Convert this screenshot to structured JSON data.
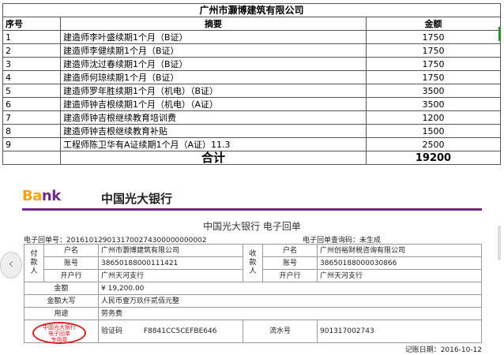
{
  "ledger": {
    "company": "广州市灏博建筑有限公司",
    "headers": {
      "no": "序号",
      "desc": "摘要",
      "amount": "金额"
    },
    "rows": [
      {
        "no": "1",
        "desc": "建造师李叶盛续期1个月（B证）",
        "amount": "1750"
      },
      {
        "no": "2",
        "desc": "建造师李健续期1个月（B证）",
        "amount": "1750"
      },
      {
        "no": "3",
        "desc": "建造师沈过春续期1个月（B证）",
        "amount": "1750"
      },
      {
        "no": "4",
        "desc": "建造师何琼续期1个月（B证）",
        "amount": "1750"
      },
      {
        "no": "5",
        "desc": "建造师罗年胜续期1个月（机电）（B证）",
        "amount": "3500"
      },
      {
        "no": "6",
        "desc": "建造师钟吉根续期1个月（机电）（A证）",
        "amount": "3500"
      },
      {
        "no": "7",
        "desc": "建造师钟吉根继续教育培训费",
        "amount": "1200"
      },
      {
        "no": "8",
        "desc": "建造师钟吉根继续教育补贴",
        "amount": "1500"
      },
      {
        "no": "9",
        "desc": "工程师陈卫华有A证续期1个月（A证）11.3",
        "amount": "2500"
      }
    ],
    "total_label": "合计",
    "total_amount": "19200",
    "accent_green": "#2e8b2e"
  },
  "bank": {
    "logo_text_1": "Ba",
    "logo_text_2": "nk",
    "name": "中国光大银行",
    "brand_purple": "#6b2c8c",
    "receipt_title": "中国光大银行  电子回单",
    "receipt_no": "电子回单号：2016101290131700274300000000002",
    "query_code": "电子回单查询码：未生成",
    "payer": {
      "side": "付\n款\n人",
      "name_label": "户名",
      "name": "广州市灏博建筑有限公司",
      "acct_label": "账号",
      "acct": "38650188000111421",
      "bank_label": "开户行",
      "bank": "广州天河支行"
    },
    "payee": {
      "side": "收\n款\n人",
      "name_label": "户名",
      "name": "广州创裕财税咨询有限公司",
      "acct_label": "账号",
      "acct": "38650188000030866",
      "bank_label": "开户行",
      "bank": "广州天河支行"
    },
    "amount_label": "金额",
    "amount": "¥ 19,200.00",
    "amount_words_label": "金额大写",
    "amount_words": "人民币壹万玖仟贰佰元整",
    "usage_label": "用途",
    "usage": "劳务费",
    "stamp_text": "中国光大银行\n电子回单\n专用章",
    "verify_label": "验证码",
    "verify": "F8841CC5CEFBE646",
    "serial_label": "流水号",
    "serial": "901317002743",
    "date": "记账日期：2016-10-12",
    "nav_icon": "chevron-left-icon"
  }
}
